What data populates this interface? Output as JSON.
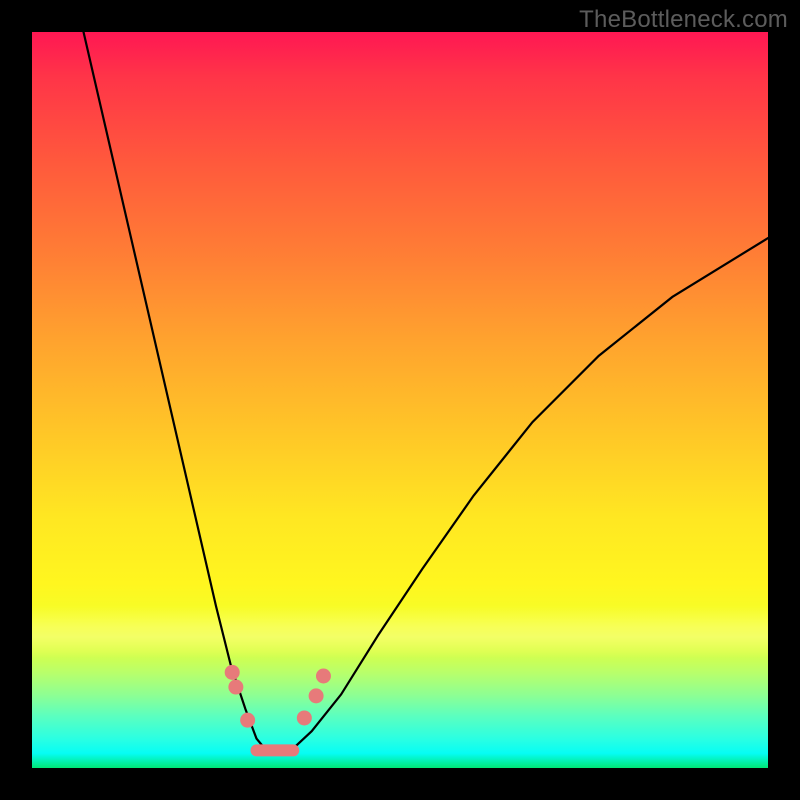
{
  "watermark": "TheBottleneck.com",
  "colors": {
    "frame": "#000000",
    "curve": "#000000",
    "marker": "#e77a7a",
    "gradient_top": "#ff1753",
    "gradient_mid": "#ffe722",
    "gradient_bottom": "#00e676"
  },
  "chart_data": {
    "type": "line",
    "title": "",
    "xlabel": "",
    "ylabel": "",
    "xlim": [
      0,
      100
    ],
    "ylim": [
      0,
      100
    ],
    "grid": false,
    "legend": false,
    "series": [
      {
        "name": "bottleneck-curve",
        "x": [
          7,
          10,
          13,
          16,
          19,
          22,
          25,
          27,
          29,
          30.5,
          32,
          33.5,
          35,
          38,
          42,
          47,
          53,
          60,
          68,
          77,
          87,
          100
        ],
        "y": [
          100,
          87,
          74,
          61,
          48,
          35,
          22,
          14,
          8,
          4,
          2.2,
          2,
          2.2,
          5,
          10,
          18,
          27,
          37,
          47,
          56,
          64,
          72
        ]
      }
    ],
    "markers": [
      {
        "x": 27.2,
        "y": 13.0
      },
      {
        "x": 27.7,
        "y": 11.0
      },
      {
        "x": 29.3,
        "y": 6.5
      },
      {
        "x": 37.0,
        "y": 6.8
      },
      {
        "x": 38.6,
        "y": 9.8
      },
      {
        "x": 39.6,
        "y": 12.5
      }
    ],
    "trough_segment": {
      "x0": 30.5,
      "x1": 35.5,
      "y": 2.4
    },
    "annotations": []
  }
}
